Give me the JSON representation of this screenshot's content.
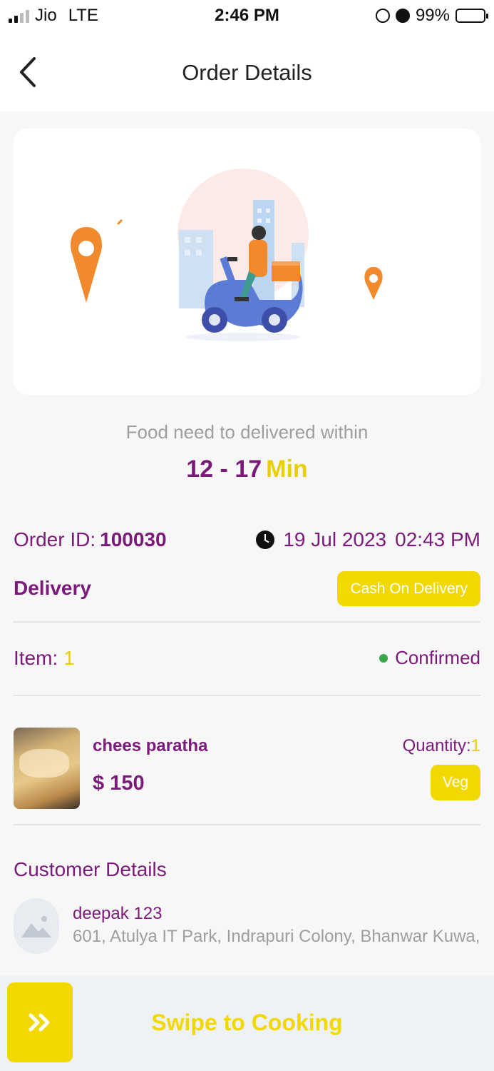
{
  "status_bar": {
    "carrier": "Jio",
    "network": "LTE",
    "time": "2:46 PM",
    "battery": "99%"
  },
  "header": {
    "title": "Order Details",
    "back_icon": "chevron-left-icon"
  },
  "illustration": {
    "name": "delivery-scooter-illustration",
    "pin_color": "#f08a2c"
  },
  "delivery_eta": {
    "caption": "Food need to delivered within",
    "range": "12 - 17",
    "unit": "Min"
  },
  "order": {
    "id_label": "Order ID:",
    "id_value": "100030",
    "date": "19 Jul 2023",
    "time": "02:43 PM",
    "type": "Delivery",
    "payment": "Cash On Delivery",
    "item_label": "Item:",
    "item_count": "1",
    "status": "Confirmed"
  },
  "product": {
    "name": "chees paratha",
    "price": "$ 150",
    "quantity_label": "Quantity:",
    "quantity": "1",
    "tag": "Veg"
  },
  "customer": {
    "section_title": "Customer Details",
    "name": "deepak 123",
    "address": "601, Atulya IT Park, Indrapuri Colony, Bhanwar Kuwa, ..."
  },
  "swipe": {
    "handle_icon": "double-chevron-right-icon",
    "label": "Swipe to Cooking"
  },
  "colors": {
    "primary_purple": "#7b1a7b",
    "accent_yellow": "#f1d800",
    "status_green": "#3aa64a"
  }
}
